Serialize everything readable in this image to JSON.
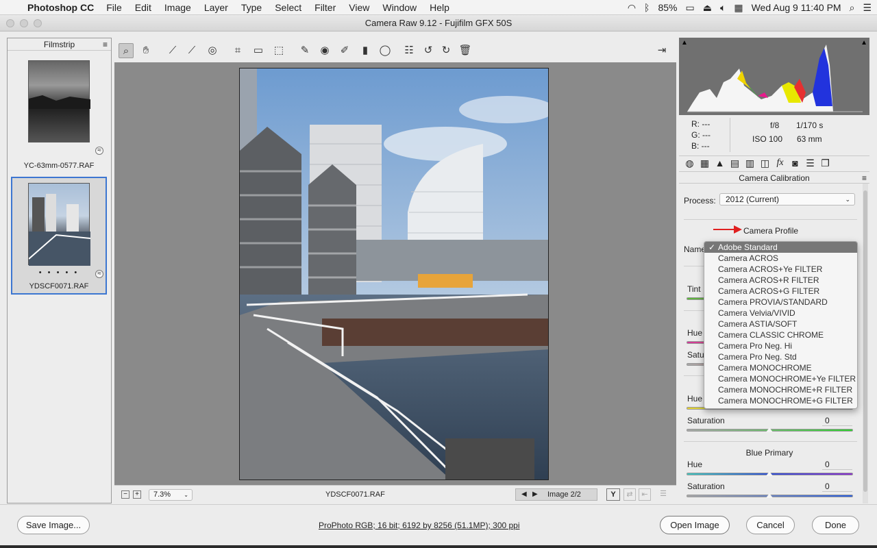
{
  "menubar": {
    "app": "Photoshop CC",
    "menus": [
      "File",
      "Edit",
      "Image",
      "Layer",
      "Type",
      "Select",
      "Filter",
      "View",
      "Window",
      "Help"
    ],
    "battery": "85%",
    "datetime": "Wed Aug 9  11:40 PM"
  },
  "window": {
    "title": "Camera Raw 9.12  -  Fujifilm GFX 50S"
  },
  "filmstrip": {
    "title": "Filmstrip",
    "items": [
      {
        "name": "YC-63mm-0577.RAF",
        "selected": false
      },
      {
        "name": "YDSCF0071.RAF",
        "selected": true,
        "dots": "• • • • •"
      }
    ]
  },
  "toolbar": {
    "tools": [
      "zoom-tool",
      "hand-tool",
      "white-balance-tool",
      "color-sampler-tool",
      "targeted-adjustment-tool",
      "crop-tool",
      "straighten-tool",
      "transform-tool",
      "spot-removal-tool",
      "red-eye-tool",
      "adjustment-brush",
      "graduated-filter",
      "radial-filter",
      "preferences",
      "rotate-ccw",
      "rotate-cw",
      "trash"
    ]
  },
  "statusbar": {
    "zoom": "7.3%",
    "filename": "YDSCF0071.RAF",
    "image_counter": "Image 2/2"
  },
  "info": {
    "r": "R:   ---",
    "g": "G:   ---",
    "b": "B:   ---",
    "aperture": "f/8",
    "shutter": "1/170 s",
    "iso": "ISO 100",
    "focal": "63 mm"
  },
  "panel": {
    "title": "Camera Calibration",
    "process_label": "Process:",
    "process_value": "2012 (Current)",
    "camera_profile_label": "Camera Profile",
    "name_label": "Name",
    "tint_label": "Tint",
    "green_primary": {
      "hue_label": "Hue",
      "sat_label": "Satu"
    },
    "blue_primary_title": "Blue Primary",
    "saturation_label": "Saturation",
    "hue_label": "Hue",
    "green_saturation_value": "0",
    "blue_hue_value": "0",
    "blue_saturation_value": "0"
  },
  "profile_menu": {
    "selected": "Adobe Standard",
    "options": [
      "Adobe Standard",
      "Camera ACROS",
      "Camera ACROS+Ye FILTER",
      "Camera ACROS+R FILTER",
      "Camera ACROS+G FILTER",
      "Camera PROVIA/STANDARD",
      "Camera Velvia/VIVID",
      "Camera ASTIA/SOFT",
      "Camera CLASSIC CHROME",
      "Camera Pro Neg. Hi",
      "Camera Pro Neg. Std",
      "Camera MONOCHROME",
      "Camera MONOCHROME+Ye FILTER",
      "Camera MONOCHROME+R FILTER",
      "Camera MONOCHROME+G FILTER"
    ]
  },
  "bottombar": {
    "save_label": "Save Image...",
    "workflow_info": "ProPhoto RGB; 16 bit; 6192 by 8256 (51.1MP); 300 ppi",
    "open_label": "Open Image",
    "cancel_label": "Cancel",
    "done_label": "Done"
  },
  "colors": {
    "accent": "#3c76d1",
    "arrow": "#e02020"
  }
}
